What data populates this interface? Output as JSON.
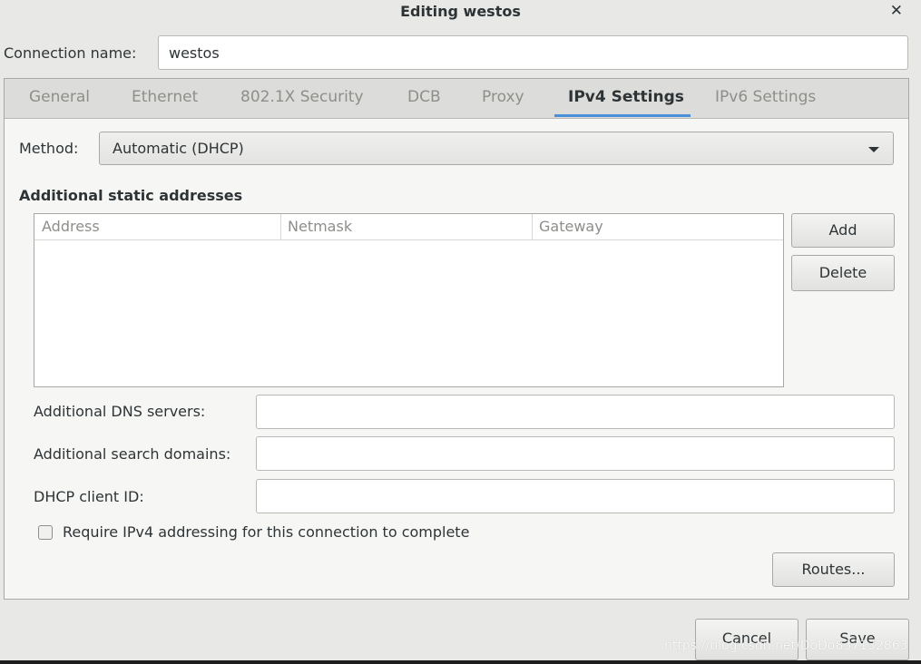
{
  "window": {
    "title": "Editing westos"
  },
  "connection": {
    "label": "Connection name:",
    "value": "westos"
  },
  "tabs": [
    {
      "label": "General"
    },
    {
      "label": "Ethernet"
    },
    {
      "label": "802.1X Security"
    },
    {
      "label": "DCB"
    },
    {
      "label": "Proxy"
    },
    {
      "label": "IPv4 Settings",
      "active": true
    },
    {
      "label": "IPv6 Settings"
    }
  ],
  "ipv4": {
    "method_label": "Method:",
    "method_value": "Automatic (DHCP)",
    "static_title": "Additional static addresses",
    "columns": [
      "Address",
      "Netmask",
      "Gateway"
    ],
    "add_label": "Add",
    "delete_label": "Delete",
    "dns_label": "Additional DNS servers:",
    "dns_value": "",
    "search_label": "Additional search domains:",
    "search_value": "",
    "dhcp_label": "DHCP client ID:",
    "dhcp_value": "",
    "require_label": "Require IPv4 addressing for this connection to complete",
    "require_checked": false,
    "routes_label": "Routes..."
  },
  "footer": {
    "cancel_label": "Cancel",
    "save_label": "Save"
  },
  "watermark": "https://blog.csdn.net/DoDo837132863",
  "icons": {
    "close": "close-icon",
    "dropdown": "chevron-down-icon"
  },
  "colors": {
    "accent": "#4a90d9",
    "background": "#e8e8e7",
    "panel": "#f6f6f5"
  }
}
